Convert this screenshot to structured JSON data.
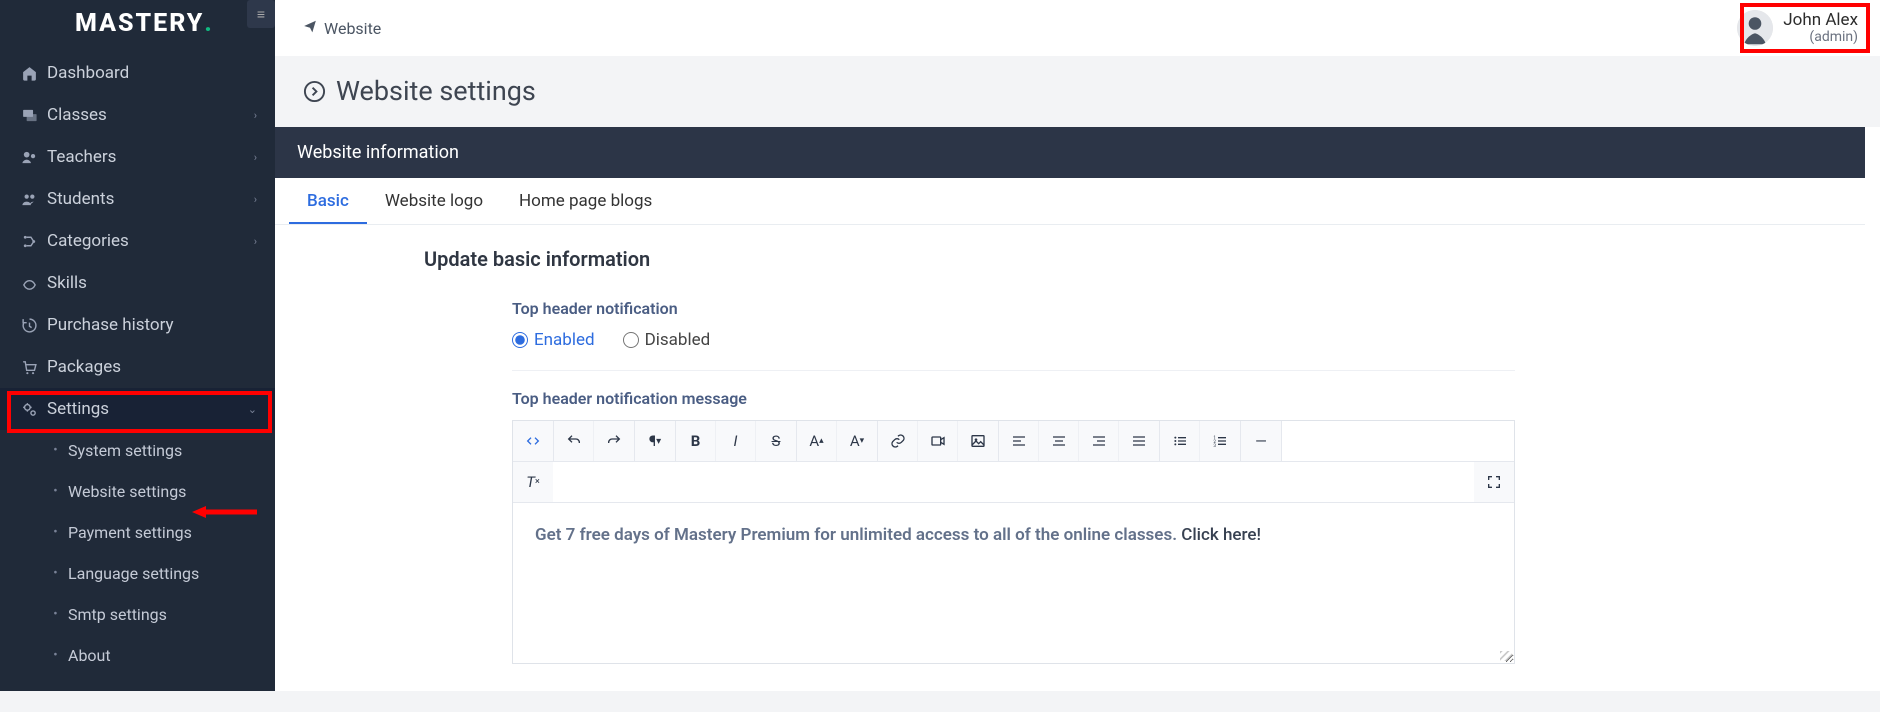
{
  "brand": {
    "name": "MASTERY"
  },
  "breadcrumb": {
    "label": "Website"
  },
  "user": {
    "name": "John Alex",
    "role": "(admin)"
  },
  "page_title": "Website settings",
  "panel_title": "Website information",
  "tabs": [
    {
      "label": "Basic",
      "active": true
    },
    {
      "label": "Website logo",
      "active": false
    },
    {
      "label": "Home page blogs",
      "active": false
    }
  ],
  "form": {
    "heading": "Update basic information",
    "notif_label": "Top header notification",
    "notif_enabled": "Enabled",
    "notif_disabled": "Disabled",
    "notif_msg_label": "Top header notification message",
    "editor_text_bold": "Get 7 free days of Mastery Premium for unlimited access to all of the online classes.",
    "editor_text_link": "Click here!"
  },
  "sidebar": {
    "items": [
      {
        "icon": "home-icon",
        "label": "Dashboard"
      },
      {
        "icon": "classes-icon",
        "label": "Classes",
        "chev": true
      },
      {
        "icon": "teachers-icon",
        "label": "Teachers",
        "chev": true
      },
      {
        "icon": "students-icon",
        "label": "Students",
        "chev": true
      },
      {
        "icon": "categories-icon",
        "label": "Categories",
        "chev": true
      },
      {
        "icon": "skills-icon",
        "label": "Skills"
      },
      {
        "icon": "history-icon",
        "label": "Purchase history"
      },
      {
        "icon": "packages-icon",
        "label": "Packages"
      },
      {
        "icon": "settings-icon",
        "label": "Settings",
        "chev": true,
        "active": true
      }
    ],
    "settings_children": [
      {
        "label": "System settings"
      },
      {
        "label": "Website settings"
      },
      {
        "label": "Payment settings"
      },
      {
        "label": "Language settings"
      },
      {
        "label": "Smtp settings"
      },
      {
        "label": "About"
      }
    ]
  },
  "editor_tb": {
    "row1": [
      [
        "code-view-icon"
      ],
      [
        "undo-icon",
        "redo-icon"
      ],
      [
        "paragraph-icon"
      ],
      [
        "bold-icon",
        "italic-icon",
        "strike-icon"
      ],
      [
        "font-inc-icon",
        "font-dec-icon"
      ],
      [
        "link-icon",
        "video-icon",
        "image-icon"
      ],
      [
        "align-left-icon",
        "align-center-icon",
        "align-right-icon",
        "align-justify-icon"
      ],
      [
        "list-ul-icon",
        "list-ol-icon"
      ],
      [
        "hr-icon"
      ]
    ],
    "row2_left": [
      "clear-format-icon"
    ],
    "row2_right": [
      "fullscreen-icon"
    ]
  }
}
